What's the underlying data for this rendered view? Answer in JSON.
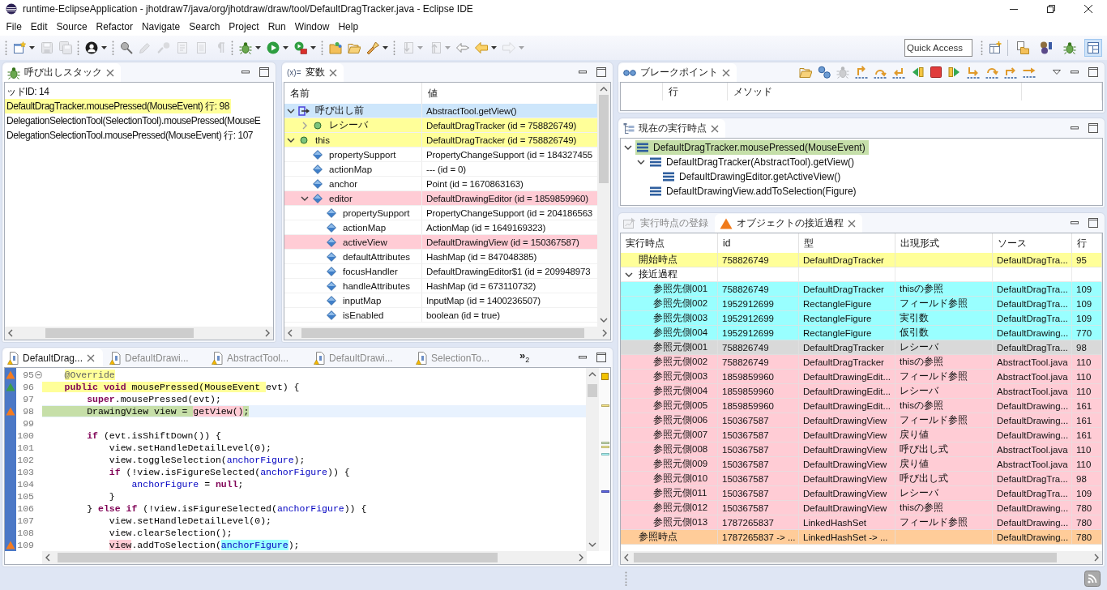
{
  "window": {
    "title": "runtime-EclipseApplication - jhotdraw7/java/org/jhotdraw/draw/tool/DefaultDragTracker.java - Eclipse IDE"
  },
  "menu": [
    {
      "label": "File"
    },
    {
      "label": "Edit"
    },
    {
      "label": "Source"
    },
    {
      "label": "Refactor"
    },
    {
      "label": "Navigate"
    },
    {
      "label": "Search"
    },
    {
      "label": "Project"
    },
    {
      "label": "Run"
    },
    {
      "label": "Window"
    },
    {
      "label": "Help"
    }
  ],
  "toolbar": {
    "groups": [
      [
        {
          "disabled": false,
          "dropdown": true
        },
        {
          "disabled": true
        },
        {
          "disabled": true
        }
      ],
      [
        {
          "disabled": false,
          "dropdown": true
        }
      ],
      [
        {
          "disabled": false
        },
        {
          "disabled": true
        },
        {
          "disabled": true
        },
        {
          "disabled": true
        },
        {
          "disabled": true
        },
        {
          "disabled": true
        }
      ],
      [
        {
          "disabled": false,
          "dropdown": true
        },
        {
          "disabled": false,
          "dropdown": true
        },
        {
          "disabled": false,
          "dropdown": true
        }
      ],
      [
        {
          "disabled": false
        },
        {
          "disabled": false
        },
        {
          "disabled": false,
          "dropdown": true
        }
      ],
      [
        {
          "disabled": true,
          "dropdown": true
        },
        {
          "disabled": true,
          "dropdown": true
        },
        {
          "disabled": false
        },
        {
          "disabled": false,
          "dropdown": true
        },
        {
          "disabled": true,
          "dropdown": true
        }
      ]
    ],
    "quick_access": {
      "placeholder": "Quick Access"
    },
    "perspectives": [
      {
        "selected": false
      },
      {
        "selected": false
      },
      {
        "selected": false
      },
      {
        "selected": true
      }
    ]
  },
  "call_stack": {
    "title": "呼び出しスタック",
    "lines": [
      {
        "text": "ッドID: 14",
        "selected": false
      },
      {
        "text": "DefaultDragTracker.mousePressed(MouseEvent) 行: 98",
        "selected": true
      },
      {
        "text": "DelegationSelectionTool(SelectionTool).mousePressed(MouseE",
        "selected": false
      },
      {
        "text": "DelegationSelectionTool.mousePressed(MouseEvent) 行: 107",
        "selected": false
      }
    ]
  },
  "variables": {
    "icon_text": "(x)=",
    "title": "変数",
    "columns": [
      "名前",
      "値"
    ],
    "rows": [
      {
        "kind": "call",
        "name": "呼び出し前",
        "value": "AbstractTool.getView()",
        "color": "#cde6fb",
        "expanded": true,
        "children": [
          {
            "kind": "object",
            "name": "レシーバ",
            "value": "DefaultDragTracker (id = 758826749)",
            "color": "#ffff99",
            "expanded": false
          }
        ]
      },
      {
        "kind": "object",
        "name": "this",
        "value": "DefaultDragTracker (id = 758826749)",
        "color": "#ffff99",
        "expanded": true,
        "children": [
          {
            "kind": "field",
            "name": "propertySupport",
            "value": "PropertyChangeSupport (id = 184327455"
          },
          {
            "kind": "field",
            "name": "actionMap",
            "value": "--- (id = 0)"
          },
          {
            "kind": "field",
            "name": "anchor",
            "value": "Point (id = 1670863163)"
          },
          {
            "kind": "field",
            "name": "editor",
            "value": "DefaultDrawingEditor (id = 1859859960)",
            "color": "#ffccd5",
            "expanded": true,
            "children": [
              {
                "kind": "field",
                "name": "propertySupport",
                "value": "PropertyChangeSupport (id = 204186563"
              },
              {
                "kind": "field",
                "name": "actionMap",
                "value": "ActionMap (id = 1649169323)"
              },
              {
                "kind": "field",
                "name": "activeView",
                "value": "DefaultDrawingView (id = 150367587)",
                "color": "#ffccd5"
              },
              {
                "kind": "field",
                "name": "defaultAttributes",
                "value": "HashMap (id = 847048385)"
              },
              {
                "kind": "field",
                "name": "focusHandler",
                "value": "DefaultDrawingEditor$1 (id = 209948973"
              },
              {
                "kind": "field",
                "name": "handleAttributes",
                "value": "HashMap (id = 673110732)"
              },
              {
                "kind": "field",
                "name": "inputMap",
                "value": "InputMap (id = 1400236507)"
              },
              {
                "kind": "field",
                "name": "isEnabled",
                "value": "boolean (id = true)"
              }
            ]
          }
        ]
      }
    ]
  },
  "editor": {
    "tabs": [
      {
        "label": "DefaultDrag...",
        "selected": true
      },
      {
        "label": "DefaultDrawi...",
        "selected": false
      },
      {
        "label": "AbstractTool...",
        "selected": false
      },
      {
        "label": "DefaultDrawi...",
        "selected": false
      },
      {
        "label": "SelectionTo...",
        "selected": false
      }
    ],
    "overflow": {
      "label": "»$_{2}$"
    },
    "lines": [
      {
        "number": "95",
        "current": false,
        "fold": true,
        "marker": {
          "color": "#f47b20"
        },
        "highlight_indent": false,
        "tokens": [
          {
            "kind": "annotation",
            "text": "    @Override",
            "color": "#ffff99"
          }
        ]
      },
      {
        "number": "96",
        "current": false,
        "fold": false,
        "marker": {
          "color": "#3d9e4a"
        },
        "highlight_indent": true,
        "tokens": [
          {
            "kind": "keyword",
            "text": "    public",
            "color": "#ffff99"
          },
          {
            "kind": "keyword",
            "text": " void",
            "color": "#ffff99"
          },
          {
            "kind": "plain",
            "text": " mousePressed(MouseEvent ",
            "color": "#ffff99"
          },
          {
            "kind": "plain",
            "text": "evt) {"
          }
        ]
      },
      {
        "number": "97",
        "current": false,
        "fold": false,
        "tokens": [
          {
            "kind": "keyword",
            "text": "        super"
          },
          {
            "kind": "plain",
            "text": ".mousePressed(evt);"
          }
        ]
      },
      {
        "number": "98",
        "current": true,
        "fold": false,
        "marker": {
          "color": "#f47b20"
        },
        "highlight_indent": true,
        "tokens": [
          {
            "kind": "plain",
            "text": "        DrawingView view = ",
            "color": "#c6dfa8"
          },
          {
            "kind": "plain",
            "text": "getView()",
            "color": "#ffccd5"
          },
          {
            "kind": "plain",
            "text": ";",
            "color": "#c6dfa8"
          }
        ]
      },
      {
        "number": "99",
        "current": false,
        "fold": false
      },
      {
        "number": "100",
        "current": false,
        "fold": false,
        "tokens": [
          {
            "kind": "keyword",
            "text": "        if"
          },
          {
            "kind": "plain",
            "text": " (evt.isShiftDown()) {"
          }
        ]
      },
      {
        "number": "101",
        "current": false,
        "fold": false,
        "tokens": [
          {
            "kind": "plain",
            "text": "            view.setHandleDetailLevel(0);"
          }
        ]
      },
      {
        "number": "102",
        "current": false,
        "fold": false,
        "tokens": [
          {
            "kind": "plain",
            "text": "            view.toggleSelection("
          },
          {
            "kind": "field",
            "text": "anchorFigure"
          },
          {
            "kind": "plain",
            "text": ");"
          }
        ]
      },
      {
        "number": "103",
        "current": false,
        "fold": false,
        "tokens": [
          {
            "kind": "keyword",
            "text": "            if"
          },
          {
            "kind": "plain",
            "text": " (!view.isFigureSelected("
          },
          {
            "kind": "field",
            "text": "anchorFigure"
          },
          {
            "kind": "plain",
            "text": ")) {"
          }
        ]
      },
      {
        "number": "104",
        "current": false,
        "fold": false,
        "tokens": [
          {
            "kind": "field",
            "text": "                anchorFigure"
          },
          {
            "kind": "plain",
            "text": " = "
          },
          {
            "kind": "keyword",
            "text": "null"
          },
          {
            "kind": "plain",
            "text": ";"
          }
        ]
      },
      {
        "number": "105",
        "current": false,
        "fold": false,
        "tokens": [
          {
            "kind": "plain",
            "text": "            }"
          }
        ]
      },
      {
        "number": "106",
        "current": false,
        "fold": false,
        "tokens": [
          {
            "kind": "plain",
            "text": "        } "
          },
          {
            "kind": "keyword",
            "text": "else"
          },
          {
            "kind": "keyword",
            "text": " if"
          },
          {
            "kind": "plain",
            "text": " (!view.isFigureSelected("
          },
          {
            "kind": "field",
            "text": "anchorFigure"
          },
          {
            "kind": "plain",
            "text": ")) {"
          }
        ]
      },
      {
        "number": "107",
        "current": false,
        "fold": false,
        "tokens": [
          {
            "kind": "plain",
            "text": "            view.setHandleDetailLevel(0);"
          }
        ]
      },
      {
        "number": "108",
        "current": false,
        "fold": false,
        "tokens": [
          {
            "kind": "plain",
            "text": "            view.clearSelection();"
          }
        ]
      },
      {
        "number": "109",
        "current": false,
        "fold": false,
        "marker": {
          "color": "#f47b20"
        },
        "highlight_indent": false,
        "tokens": [
          {
            "kind": "plain",
            "text": "            view",
            "color": "#ffccd5"
          },
          {
            "kind": "plain",
            "text": ".addToSelection("
          },
          {
            "kind": "field",
            "text": "anchorFigure",
            "color": "#99ffff"
          },
          {
            "kind": "plain",
            "text": ");"
          }
        ]
      }
    ]
  },
  "breakpoints": {
    "title": "ブレークポイント",
    "toolbar": [
      {
        "disabled": false
      },
      {
        "disabled": false
      },
      {
        "disabled": true
      },
      {
        "disabled": false
      },
      {
        "disabled": false
      },
      {
        "disabled": false
      },
      {
        "disabled": false
      },
      {
        "disabled": false
      },
      {
        "disabled": false
      },
      {
        "disabled": false
      },
      {
        "disabled": false
      },
      {
        "disabled": false
      },
      {
        "disabled": false
      }
    ],
    "columns": [
      "行",
      "メソッド"
    ]
  },
  "execution_point": {
    "title": "現在の実行時点",
    "tree": [
      {
        "label": "DefaultDragTracker.mousePressed(MouseEvent)",
        "selected": true,
        "expanded": true,
        "children": [
          {
            "label": "DefaultDragTracker(AbstractTool).getView()",
            "selected": false,
            "expanded": true,
            "children": [
              {
                "label": "DefaultDrawingEditor.getActiveView()",
                "selected": false
              }
            ]
          },
          {
            "label": "DefaultDrawingView.addToSelection(Figure)",
            "selected": false
          }
        ]
      }
    ]
  },
  "trace": {
    "tabs": [
      {
        "label": "実行時点の登録",
        "selected": false
      },
      {
        "label": "オブジェクトの接近過程",
        "selected": true
      }
    ],
    "columns": [
      "実行時点",
      "id",
      "型",
      "出現形式",
      "ソース",
      "行"
    ],
    "rows": [
      {
        "point": "開始時点",
        "id": "758826749",
        "type_name": "DefaultDragTracker",
        "source": "DefaultDragTra...",
        "line": "95",
        "color": "#ffff99"
      },
      {
        "point": "接近過程",
        "expanded": true,
        "children": [
          {
            "point": "参照先側001",
            "id": "758826749",
            "type_name": "DefaultDragTracker",
            "occurrence": "thisの参照",
            "source": "DefaultDragTra...",
            "line": "109",
            "color": "#99ffff"
          },
          {
            "point": "参照先側002",
            "id": "1952912699",
            "type_name": "RectangleFigure",
            "occurrence": "フィールド参照",
            "source": "DefaultDragTra...",
            "line": "109",
            "color": "#99ffff"
          },
          {
            "point": "参照先側003",
            "id": "1952912699",
            "type_name": "RectangleFigure",
            "occurrence": "実引数",
            "source": "DefaultDragTra...",
            "line": "109",
            "color": "#99ffff"
          },
          {
            "point": "参照先側004",
            "id": "1952912699",
            "type_name": "RectangleFigure",
            "occurrence": "仮引数",
            "source": "DefaultDrawing...",
            "line": "770",
            "color": "#99ffff"
          },
          {
            "point": "参照元側001",
            "id": "758826749",
            "type_name": "DefaultDragTracker",
            "occurrence": "レシーバ",
            "source": "DefaultDragTra...",
            "line": "98",
            "color": "#d9d9d9"
          },
          {
            "point": "参照元側002",
            "id": "758826749",
            "type_name": "DefaultDragTracker",
            "occurrence": "thisの参照",
            "source": "AbstractTool.java",
            "line": "110",
            "color": "#ffccd5"
          },
          {
            "point": "参照元側003",
            "id": "1859859960",
            "type_name": "DefaultDrawingEdit...",
            "occurrence": "フィールド参照",
            "source": "AbstractTool.java",
            "line": "110",
            "color": "#ffccd5"
          },
          {
            "point": "参照元側004",
            "id": "1859859960",
            "type_name": "DefaultDrawingEdit...",
            "occurrence": "レシーバ",
            "source": "AbstractTool.java",
            "line": "110",
            "color": "#ffccd5"
          },
          {
            "point": "参照元側005",
            "id": "1859859960",
            "type_name": "DefaultDrawingEdit...",
            "occurrence": "thisの参照",
            "source": "DefaultDrawing...",
            "line": "161",
            "color": "#ffccd5"
          },
          {
            "point": "参照元側006",
            "id": "150367587",
            "type_name": "DefaultDrawingView",
            "occurrence": "フィールド参照",
            "source": "DefaultDrawing...",
            "line": "161",
            "color": "#ffccd5"
          },
          {
            "point": "参照元側007",
            "id": "150367587",
            "type_name": "DefaultDrawingView",
            "occurrence": "戻り値",
            "source": "DefaultDrawing...",
            "line": "161",
            "color": "#ffccd5"
          },
          {
            "point": "参照元側008",
            "id": "150367587",
            "type_name": "DefaultDrawingView",
            "occurrence": "呼び出し式",
            "source": "AbstractTool.java",
            "line": "110",
            "color": "#ffccd5"
          },
          {
            "point": "参照元側009",
            "id": "150367587",
            "type_name": "DefaultDrawingView",
            "occurrence": "戻り値",
            "source": "AbstractTool.java",
            "line": "110",
            "color": "#ffccd5"
          },
          {
            "point": "参照元側010",
            "id": "150367587",
            "type_name": "DefaultDrawingView",
            "occurrence": "呼び出し式",
            "source": "DefaultDragTra...",
            "line": "98",
            "color": "#ffccd5"
          },
          {
            "point": "参照元側011",
            "id": "150367587",
            "type_name": "DefaultDrawingView",
            "occurrence": "レシーバ",
            "source": "DefaultDragTra...",
            "line": "109",
            "color": "#ffccd5"
          },
          {
            "point": "参照元側012",
            "id": "150367587",
            "type_name": "DefaultDrawingView",
            "occurrence": "thisの参照",
            "source": "DefaultDrawing...",
            "line": "780",
            "color": "#ffccd5"
          },
          {
            "point": "参照元側013",
            "id": "1787265837",
            "type_name": "LinkedHashSet",
            "occurrence": "フィールド参照",
            "source": "DefaultDrawing...",
            "line": "780",
            "color": "#ffccd5"
          }
        ]
      },
      {
        "point": "参照時点",
        "id": "1787265837 -> ...",
        "type_name": "LinkedHashSet -> ...",
        "source": "DefaultDrawing...",
        "line": "780",
        "color": "#ffcc99"
      }
    ]
  }
}
